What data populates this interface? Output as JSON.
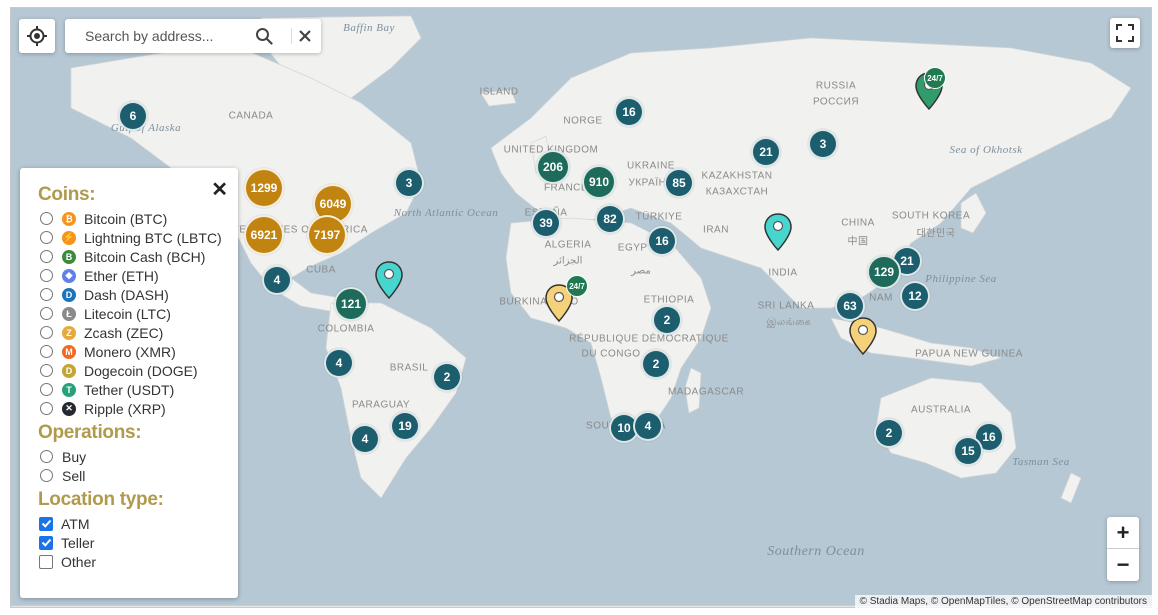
{
  "search": {
    "placeholder": "Search by address..."
  },
  "map_labels": [
    {
      "text": "Baffin Bay",
      "kind": "sea"
    },
    {
      "text": "Gulf of Alaska",
      "kind": "sea"
    },
    {
      "text": "CANADA",
      "kind": "country"
    },
    {
      "text": "UNITED STATES OF AMERICA",
      "kind": "country"
    },
    {
      "text": "North Atlantic Ocean",
      "kind": "sea"
    },
    {
      "text": "CUBA",
      "kind": "country"
    },
    {
      "text": "COLOMBIA",
      "kind": "country"
    },
    {
      "text": "BRASIL",
      "kind": "country"
    },
    {
      "text": "PARAGUAY",
      "kind": "country"
    },
    {
      "text": "ISLAND",
      "kind": "country"
    },
    {
      "text": "NORGE",
      "kind": "country"
    },
    {
      "text": "UNITED KINGDOM",
      "kind": "country"
    },
    {
      "text": "FRANCE",
      "kind": "country"
    },
    {
      "text": "ESPAÑA",
      "kind": "country"
    },
    {
      "text": "ALGERIA",
      "kind": "country"
    },
    {
      "text": "الجزائر",
      "kind": "country"
    },
    {
      "text": "BURKINA FASO",
      "kind": "country"
    },
    {
      "text": "RÉPUBLIQUE DÉMOCRATIQUE",
      "kind": "country"
    },
    {
      "text": "DU CONGO",
      "kind": "country"
    },
    {
      "text": "MADAGASCAR",
      "kind": "country"
    },
    {
      "text": "SOUTH AFRICA",
      "kind": "country"
    },
    {
      "text": "ETHIOPIA",
      "kind": "country"
    },
    {
      "text": "EGYPT",
      "kind": "country"
    },
    {
      "text": "مصر",
      "kind": "country"
    },
    {
      "text": "TÜRKIYE",
      "kind": "country"
    },
    {
      "text": "UKRAINE",
      "kind": "country"
    },
    {
      "text": "УКРАЇНА",
      "kind": "country"
    },
    {
      "text": "KAZAKHSTAN",
      "kind": "country"
    },
    {
      "text": "КАЗАХСТАН",
      "kind": "country"
    },
    {
      "text": "RUSSIA",
      "kind": "country"
    },
    {
      "text": "РОССИЯ",
      "kind": "country"
    },
    {
      "text": "IRAN",
      "kind": "country"
    },
    {
      "text": "INDIA",
      "kind": "country"
    },
    {
      "text": "SRI LANKA",
      "kind": "country"
    },
    {
      "text": "இலங்கை",
      "kind": "country"
    },
    {
      "text": "CHINA",
      "kind": "country"
    },
    {
      "text": "中国",
      "kind": "country"
    },
    {
      "text": "SOUTH KOREA",
      "kind": "country"
    },
    {
      "text": "대한민국",
      "kind": "country"
    },
    {
      "text": "Sea of Okhotsk",
      "kind": "sea"
    },
    {
      "text": "Philippine Sea",
      "kind": "sea"
    },
    {
      "text": "NAM",
      "kind": "country"
    },
    {
      "text": "PAPUA NEW GUINEA",
      "kind": "country"
    },
    {
      "text": "AUSTRALIA",
      "kind": "country"
    },
    {
      "text": "Tasman Sea",
      "kind": "sea"
    },
    {
      "text": "Southern Ocean",
      "kind": "ocean"
    }
  ],
  "clusters": [
    {
      "count": "6",
      "style": "teal"
    },
    {
      "count": "1299",
      "style": "gold"
    },
    {
      "count": "6049",
      "style": "gold"
    },
    {
      "count": "6921",
      "style": "gold"
    },
    {
      "count": "7197",
      "style": "gold"
    },
    {
      "count": "3",
      "style": "teal"
    },
    {
      "count": "4",
      "style": "teal"
    },
    {
      "count": "121",
      "style": "green"
    },
    {
      "count": "4",
      "style": "teal"
    },
    {
      "count": "2",
      "style": "teal"
    },
    {
      "count": "19",
      "style": "teal"
    },
    {
      "count": "4",
      "style": "teal"
    },
    {
      "count": "16",
      "style": "teal"
    },
    {
      "count": "206",
      "style": "green"
    },
    {
      "count": "910",
      "style": "green"
    },
    {
      "count": "85",
      "style": "teal"
    },
    {
      "count": "39",
      "style": "teal"
    },
    {
      "count": "82",
      "style": "teal"
    },
    {
      "count": "16",
      "style": "teal"
    },
    {
      "count": "21",
      "style": "teal"
    },
    {
      "count": "3",
      "style": "teal"
    },
    {
      "count": "2",
      "style": "teal"
    },
    {
      "count": "2",
      "style": "teal"
    },
    {
      "count": "10",
      "style": "teal"
    },
    {
      "count": "4",
      "style": "teal"
    },
    {
      "count": "21",
      "style": "teal"
    },
    {
      "count": "129",
      "style": "green"
    },
    {
      "count": "12",
      "style": "teal"
    },
    {
      "count": "63",
      "style": "teal"
    },
    {
      "count": "2",
      "style": "teal"
    },
    {
      "count": "16",
      "style": "teal"
    },
    {
      "count": "15",
      "style": "teal"
    }
  ],
  "pins": [
    {
      "color": "#47d6cf",
      "badge": ""
    },
    {
      "color": "#f5d27a",
      "badge": "24/7"
    },
    {
      "color": "#47d6cf",
      "badge": ""
    },
    {
      "color": "#f5d27a",
      "badge": ""
    },
    {
      "color": "#2f9c6a",
      "badge": "24/7"
    }
  ],
  "attribution": "© Stadia Maps, © OpenMapTiles, © OpenStreetMap contributors",
  "zoom": {
    "in": "+",
    "out": "−"
  },
  "panel": {
    "coins_title": "Coins:",
    "coins": [
      {
        "label": "Bitcoin (BTC)",
        "color": "#f7931a",
        "glyph": "₿",
        "icon": "bitcoin-icon"
      },
      {
        "label": "Lightning BTC (LBTC)",
        "color": "#f7931a",
        "glyph": "⚡",
        "icon": "lightning-icon"
      },
      {
        "label": "Bitcoin Cash (BCH)",
        "color": "#3c8a3f",
        "glyph": "B",
        "icon": "bitcoin-cash-icon"
      },
      {
        "label": "Ether (ETH)",
        "color": "#627eea",
        "glyph": "◆",
        "icon": "ether-icon"
      },
      {
        "label": "Dash (DASH)",
        "color": "#1c75bc",
        "glyph": "D",
        "icon": "dash-icon"
      },
      {
        "label": "Litecoin (LTC)",
        "color": "#8a8a8a",
        "glyph": "Ł",
        "icon": "litecoin-icon"
      },
      {
        "label": "Zcash (ZEC)",
        "color": "#e5a93d",
        "glyph": "Z",
        "icon": "zcash-icon"
      },
      {
        "label": "Monero (XMR)",
        "color": "#f26822",
        "glyph": "M",
        "icon": "monero-icon"
      },
      {
        "label": "Dogecoin (DOGE)",
        "color": "#c2a633",
        "glyph": "D",
        "icon": "dogecoin-icon"
      },
      {
        "label": "Tether (USDT)",
        "color": "#26a17b",
        "glyph": "T",
        "icon": "tether-icon"
      },
      {
        "label": "Ripple (XRP)",
        "color": "#23292f",
        "glyph": "✕",
        "icon": "ripple-icon"
      }
    ],
    "operations_title": "Operations:",
    "operations": [
      {
        "label": "Buy"
      },
      {
        "label": "Sell"
      }
    ],
    "location_title": "Location type:",
    "location_types": [
      {
        "label": "ATM",
        "checked": true
      },
      {
        "label": "Teller",
        "checked": true
      },
      {
        "label": "Other",
        "checked": false
      }
    ]
  }
}
